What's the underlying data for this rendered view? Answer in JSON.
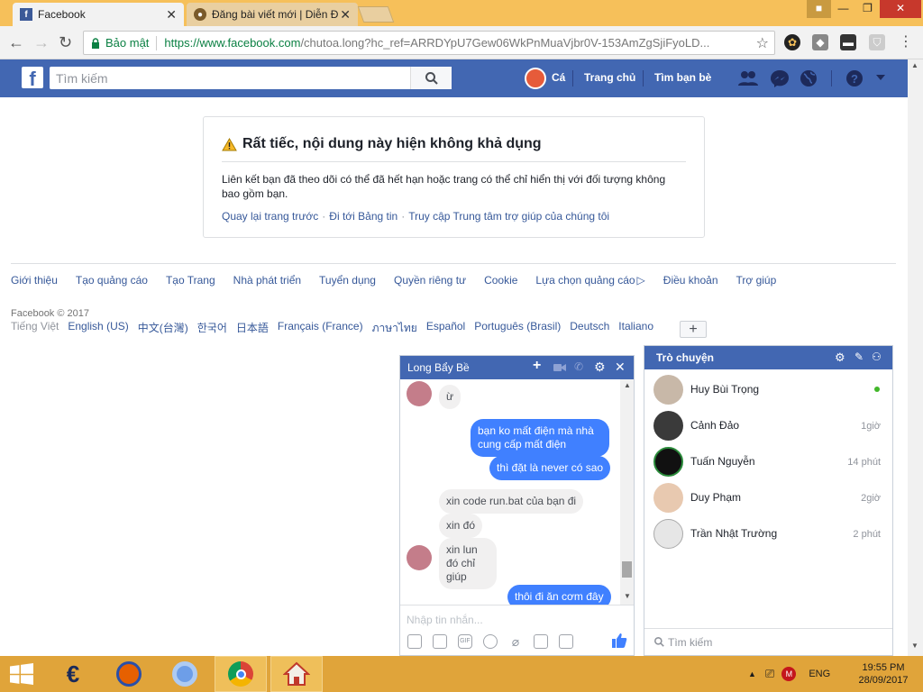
{
  "browser": {
    "tabs": [
      {
        "title": "Facebook",
        "active": true
      },
      {
        "title": "Đăng bài viết mới | Diễn Đ",
        "active": false
      }
    ],
    "secure_label": "Bảo mật",
    "url_host": "https://www.facebook.com",
    "url_path": "/chutoa.long?hc_ref=ARRDYpU7Gew06WkPnMuaVjbr0V-153AmZgSjiFyoLD..."
  },
  "fb": {
    "search_placeholder": "Tìm kiếm",
    "user_name": "Cá",
    "nav_home": "Trang chủ",
    "nav_find_friends": "Tìm bạn bè",
    "brand_color": "#4267b2"
  },
  "notice": {
    "title": "Rất tiếc, nội dung này hiện không khả dụng",
    "body": "Liên kết bạn đã theo dõi có thể đã hết hạn hoặc trang có thể chỉ hiển thị với đối tượng không bao gồm bạn.",
    "link_back": "Quay lại trang trước",
    "link_feed": "Đi tới Bảng tin",
    "link_help": "Truy cập Trung tâm trợ giúp của chúng tôi"
  },
  "footer": {
    "links": [
      "Giới thiệu",
      "Tạo quảng cáo",
      "Tạo Trang",
      "Nhà phát triển",
      "Tuyển dụng",
      "Quyền riêng tư",
      "Cookie",
      "Lựa chọn quảng cáo",
      "Điều khoản",
      "Trợ giúp"
    ],
    "copyright": "Facebook © 2017",
    "current_lang": "Tiếng Việt",
    "languages": [
      "English (US)",
      "中文(台灣)",
      "한국어",
      "日本語",
      "Français (France)",
      "ภาษาไทย",
      "Español",
      "Português (Brasil)",
      "Deutsch",
      "Italiano"
    ],
    "plus_label": "+"
  },
  "chat": {
    "contact_name": "Long Bẩy Bề",
    "messages": [
      {
        "from": "them",
        "text": "ừ"
      },
      {
        "from": "me",
        "text": "bạn ko mất điện mà nhà cung cấp mất điện"
      },
      {
        "from": "me",
        "text": "thì đặt là never có sao"
      },
      {
        "from": "them",
        "text": "xin code run.bat của bạn đi"
      },
      {
        "from": "them",
        "text": "xin đó"
      },
      {
        "from": "them",
        "text": "xin lun đó chỉ giúp"
      },
      {
        "from": "me",
        "text": "thôi đi ăn cơm đây"
      }
    ],
    "input_placeholder": "Nhập tin nhắn...",
    "gif_label": "GIF"
  },
  "sidebar_chat": {
    "title": "Trò chuyện",
    "friends": [
      {
        "name": "Huy Bùi Trọng",
        "status": "",
        "online": true
      },
      {
        "name": "Cảnh Đảo",
        "status": "1giờ",
        "online": false
      },
      {
        "name": "Tuấn Nguyễn",
        "status": "14 phút",
        "online": false
      },
      {
        "name": "Duy Phạm",
        "status": "2giờ",
        "online": false
      },
      {
        "name": "Trần Nhật Trường",
        "status": "2 phút",
        "online": false
      }
    ],
    "search_placeholder": "Tìm kiếm"
  },
  "taskbar": {
    "lang": "ENG",
    "time": "19:55 PM",
    "date": "28/09/2017",
    "color": "#e0a43a"
  }
}
